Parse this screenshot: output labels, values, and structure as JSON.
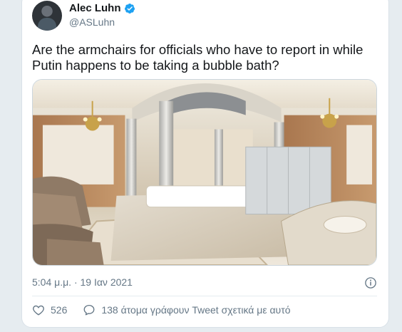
{
  "tweet": {
    "author": {
      "display_name": "Alec Luhn",
      "handle": "@ASLuhn",
      "verified": true
    },
    "text": "Are the armchairs for officials who have to report in while Putin happens to be taking a bubble bath?",
    "timestamp": "5:04 μ.μ. · 19 Ιαν 2021",
    "actions": {
      "like_count": "526",
      "conversation_label": "138 άτομα γράφουν Tweet σχετικά με αυτό"
    }
  },
  "colors": {
    "text_primary": "#14171a",
    "text_secondary": "#657786",
    "verified_blue": "#1da1f2",
    "background": "#e6ecf0"
  },
  "icons": {
    "verified": "verified-badge-icon",
    "info": "info-icon",
    "like": "heart-icon",
    "reply": "speech-bubble-icon"
  }
}
